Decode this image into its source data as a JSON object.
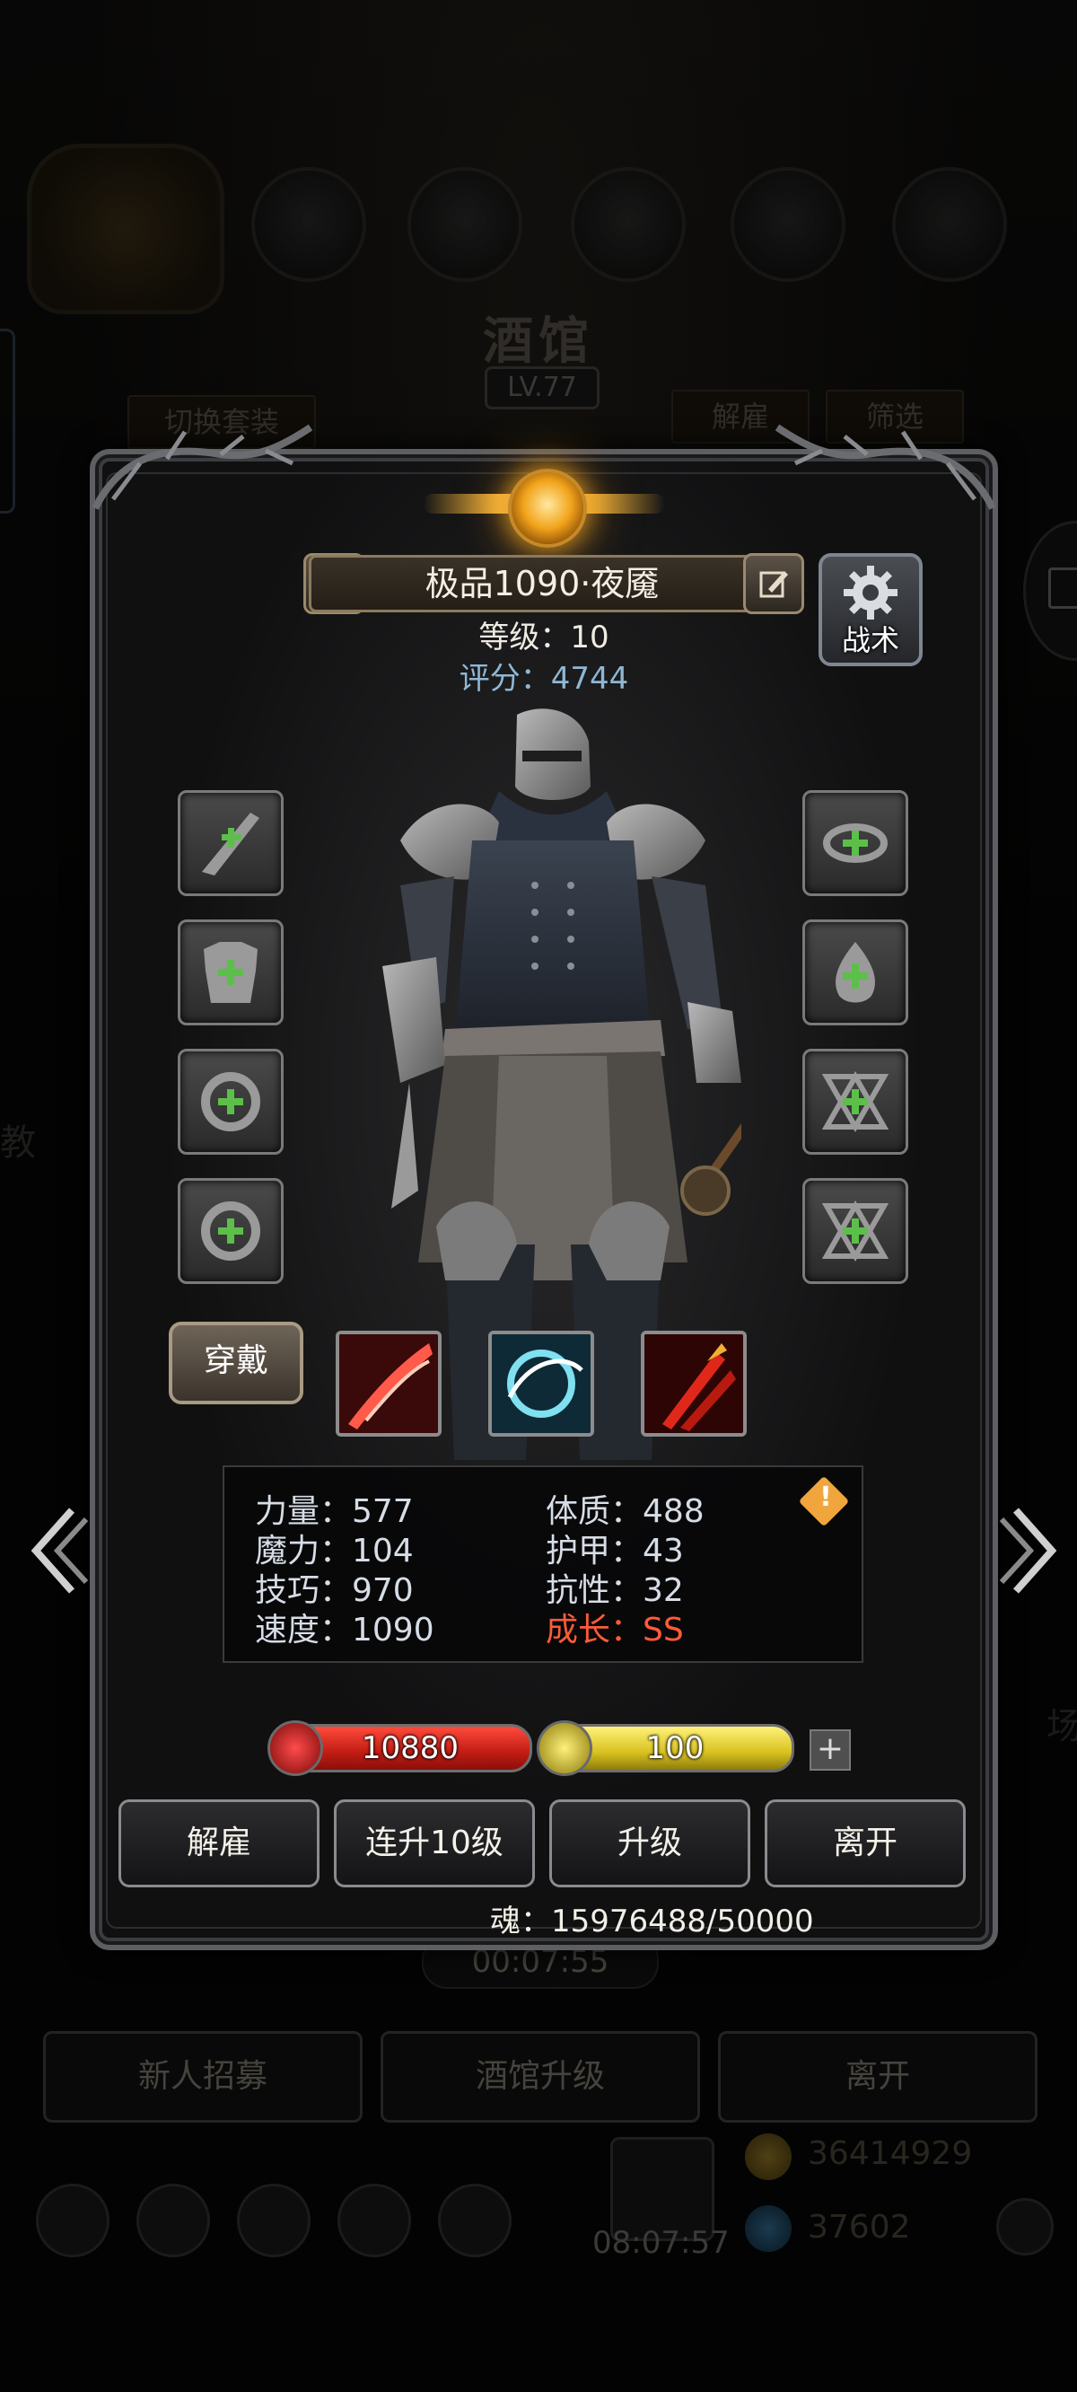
{
  "background": {
    "title": "酒馆",
    "level": "LV.77",
    "tabs": {
      "switch_outfit": "切换套装",
      "dismiss": "解雇",
      "filter": "筛选"
    },
    "timer": "00:07:55",
    "buttons": {
      "recruit": "新人招募",
      "upgrade_tavern": "酒馆升级",
      "leave": "离开"
    },
    "gift_timer": "08:07:57",
    "gold": "36414929",
    "gems": "37602",
    "left_side_text": "教",
    "right_side_text": "场"
  },
  "hero": {
    "name": "极品1090·夜魇",
    "level_label": "等级：10",
    "score_label": "评分：4744",
    "tactic_label": "战术"
  },
  "slots": {
    "left": [
      "weapon-slot",
      "armor-slot",
      "ring-slot",
      "ring-slot"
    ],
    "right": [
      "helmet-slot",
      "amulet-slot",
      "rune-slot",
      "rune-slot"
    ]
  },
  "wear_button": "穿戴",
  "skills": [
    "skill-slash",
    "skill-whirl",
    "skill-claw"
  ],
  "stats": {
    "strength": "力量：577",
    "magic": "魔力：104",
    "skill": "技巧：970",
    "speed": "速度：1090",
    "constitution": "体质：488",
    "armor": "护甲：43",
    "resist": "抗性：32",
    "growth": "成长：SS",
    "growth_color": "#ff5a3a"
  },
  "bars": {
    "hp": "10880",
    "energy": "100"
  },
  "actions": {
    "dismiss": "解雇",
    "level10": "连升10级",
    "upgrade": "升级",
    "leave": "离开"
  },
  "soul": "魂：15976488/50000",
  "colors": {
    "accent_gold": "#f2a31b",
    "score_blue": "#8fb7d4"
  }
}
